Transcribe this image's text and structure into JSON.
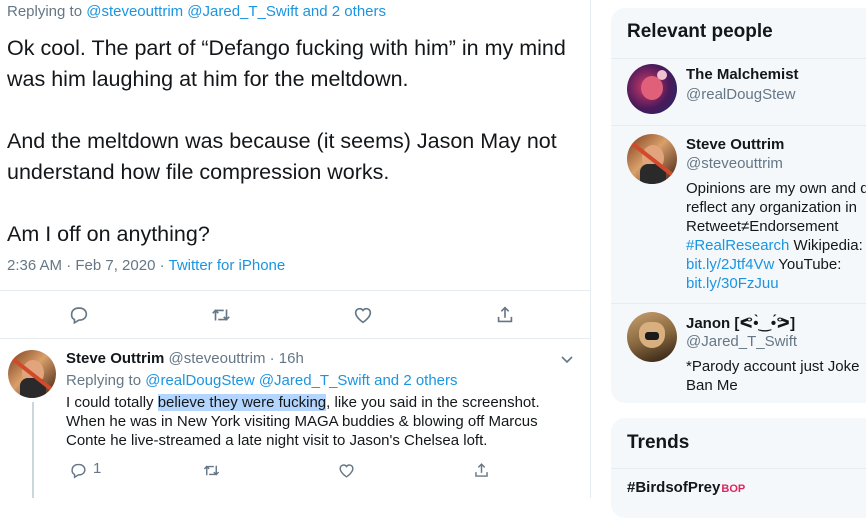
{
  "main_tweet": {
    "replying_to_prefix": "Replying to",
    "replying_to_users": "@steveouttrim @Jared_T_Swift",
    "replying_to_and": "and",
    "replying_to_others": "2 others",
    "text": "Ok cool. The part of “Defango fucking with him” in my mind was him laughing at him for the meltdown.\n\nAnd the meltdown was because (it seems) Jason May not understand how file compression works.\n\nAm I off on anything?",
    "time": "2:36 AM · Feb 7, 2020 ·",
    "source": "Twitter for iPhone",
    "actions": {
      "reply_icon": "reply-icon",
      "retweet_icon": "retweet-icon",
      "like_icon": "heart-icon",
      "share_icon": "share-icon"
    }
  },
  "reply_tweet": {
    "name": "Steve Outtrim",
    "handle": "@steveouttrim",
    "time": "· 16h",
    "replying_to_prefix": "Replying to",
    "replying_to_users": "@realDougStew @Jared_T_Swift",
    "replying_to_and": "and",
    "replying_to_others": "2 others",
    "text_before": "I could totally ",
    "text_highlight": "believe they were fucking",
    "text_after": ", like you said in the screenshot. When he was in New York visiting MAGA buddies & blowing off Marcus Conte he live-streamed a late night visit to Jason's Chelsea loft.",
    "reply_count": "1"
  },
  "sidebar": {
    "relevant_title": "Relevant people",
    "people": [
      {
        "name": "The Malchemist",
        "handle": "@realDougStew",
        "bio": []
      },
      {
        "name": "Steve Outtrim",
        "handle": "@steveouttrim",
        "bio_line1": "Opinions are my own and d",
        "bio_line2": "reflect any organization in",
        "bio_line3": "Retweet≠Endorsement",
        "bio_tag": "#RealResearch",
        "bio_wiki": " Wikipedia:",
        "bio_link1": "bit.ly/2Jtf4Vw",
        "bio_youtube": " YouTube:",
        "bio_link2": "bit.ly/30FzJuu"
      },
      {
        "name": "Janon [ᕙ•̀‿•́ᕗ]",
        "handle": "@Jared_T_Swift",
        "bio_line1": "*Parody account just Joke",
        "bio_line2": "Ban Me"
      }
    ],
    "trends_title": "Trends",
    "trend1": "#BirdsofPrey",
    "trend1_badge": "BOP"
  },
  "colors": {
    "link": "#1b95e0",
    "muted": "#657786",
    "highlight": "#b4d5fe",
    "card_bg": "#f5f8fa"
  }
}
